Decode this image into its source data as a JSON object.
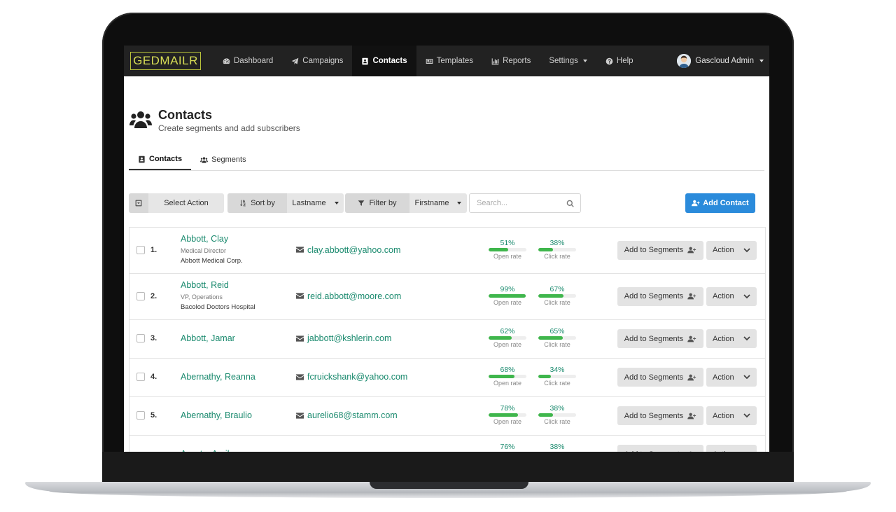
{
  "app": {
    "brand": "GEDMAILR",
    "nav": [
      {
        "label": "Dashboard",
        "icon": "dashboard-icon"
      },
      {
        "label": "Campaigns",
        "icon": "paper-plane-icon"
      },
      {
        "label": "Contacts",
        "icon": "address-book-icon",
        "active": true
      },
      {
        "label": "Templates",
        "icon": "newspaper-icon"
      },
      {
        "label": "Reports",
        "icon": "bar-chart-icon"
      },
      {
        "label": "Settings",
        "icon": "",
        "dropdown": true
      },
      {
        "label": "Help",
        "icon": "question-circle-icon"
      }
    ],
    "user": {
      "name": "Gascloud Admin"
    }
  },
  "page": {
    "title": "Contacts",
    "subtitle": "Create segments and add subscribers"
  },
  "tabs": [
    {
      "label": "Contacts",
      "active": true
    },
    {
      "label": "Segments",
      "active": false
    }
  ],
  "toolbar": {
    "select_action": "Select Action",
    "sort_by": "Sort by",
    "sort_value": "Lastname",
    "filter_by": "Filter by",
    "filter_value": "Firstname",
    "search_placeholder": "Search...",
    "add_contact": "Add Contact"
  },
  "row_buttons": {
    "add_to_segments": "Add to Segments",
    "action": "Action",
    "open_rate_label": "Open rate",
    "click_rate_label": "Click rate"
  },
  "contacts": [
    {
      "num": "1.",
      "name": "Abbott, Clay",
      "title": "Medical Director",
      "company": "Abbott Medical Corp.",
      "email": "clay.abbott@yahoo.com",
      "open": "51%",
      "open_value": 51,
      "click": "38%",
      "click_value": 38
    },
    {
      "num": "2.",
      "name": "Abbott, Reid",
      "title": "VP, Operations",
      "company": "Bacolod Doctors Hospital",
      "email": "reid.abbott@moore.com",
      "open": "99%",
      "open_value": 99,
      "click": "67%",
      "click_value": 67
    },
    {
      "num": "3.",
      "name": "Abbott, Jamar",
      "title": "",
      "company": "",
      "email": "jabbott@kshlerin.com",
      "open": "62%",
      "open_value": 62,
      "click": "65%",
      "click_value": 65
    },
    {
      "num": "4.",
      "name": "Abernathy, Reanna",
      "title": "",
      "company": "",
      "email": "fcruickshank@yahoo.com",
      "open": "68%",
      "open_value": 68,
      "click": "34%",
      "click_value": 34
    },
    {
      "num": "5.",
      "name": "Abernathy, Braulio",
      "title": "",
      "company": "",
      "email": "aurelio68@stamm.com",
      "open": "78%",
      "open_value": 78,
      "click": "38%",
      "click_value": 38
    },
    {
      "num": "",
      "name": "Acosta, April",
      "title": "",
      "company": "",
      "email": "",
      "open": "76%",
      "open_value": 76,
      "click": "38%",
      "click_value": 38
    }
  ]
}
